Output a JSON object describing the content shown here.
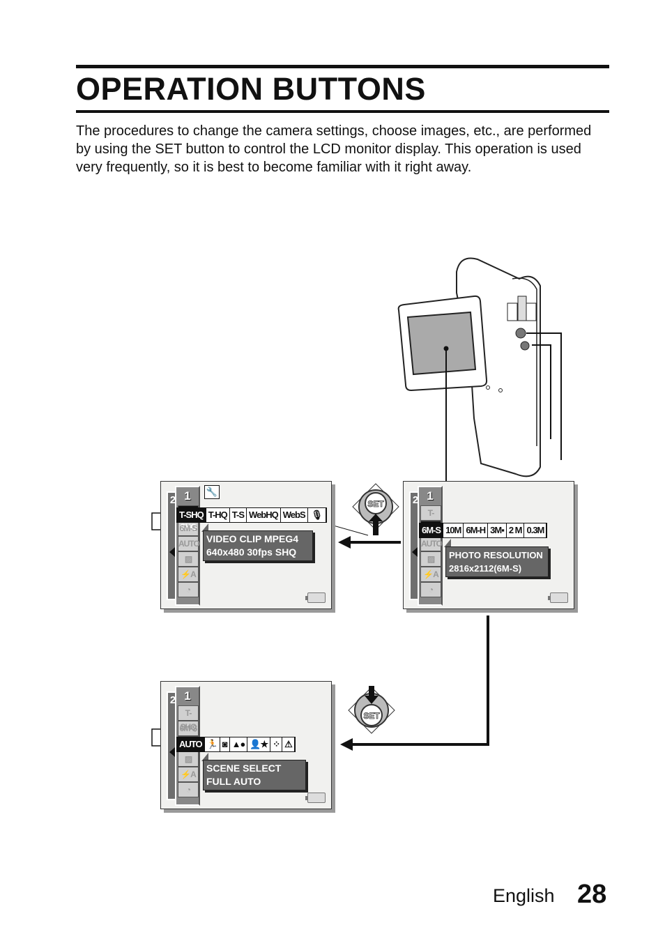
{
  "title": "OPERATION BUTTONS",
  "intro": "The procedures to change the camera settings, choose images, etc., are performed by using the SET button to control the LCD monitor display. This operation is used very frequently, so it is best to become familiar with it right away.",
  "set_label": "SET",
  "menu": {
    "tab1": "1",
    "tab2": "2",
    "items": [
      "T-SHQ",
      "6M-S",
      "AUTO",
      "grid-icon",
      "⚡A",
      "timer-icon"
    ]
  },
  "screens": [
    {
      "row": [
        "T-SHQ",
        "T-HQ",
        "T-S",
        "WebHQ",
        "WebS",
        "🎙"
      ],
      "tooltip": [
        "VIDEO CLIP MPEG4",
        "640x480 30fps SHQ"
      ]
    },
    {
      "row": [
        "6M-S",
        "10M",
        "6M-H",
        "3M▪",
        "2 M",
        "0.3M"
      ],
      "tooltip": [
        "PHOTO RESOLUTION",
        "2816x2112(6M-S)"
      ]
    },
    {
      "row": [
        "AUTO",
        "🏃",
        "◙",
        "▲●",
        "👤★",
        "⁘",
        "⚠"
      ],
      "tooltip": [
        "SCENE SELECT",
        "FULL AUTO"
      ]
    }
  ],
  "footer": {
    "language": "English",
    "page": "28"
  }
}
